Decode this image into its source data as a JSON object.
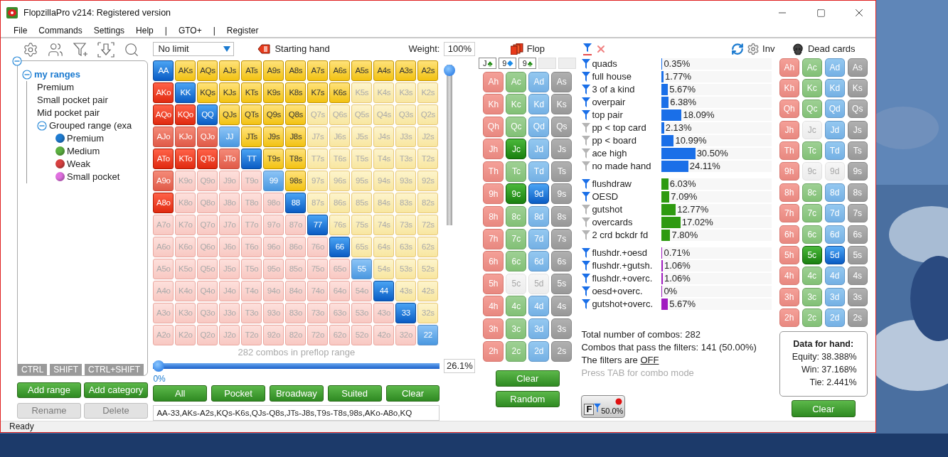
{
  "window": {
    "title": "FlopzillaPro v214: Registered version"
  },
  "menu": [
    "File",
    "Commands",
    "Settings",
    "Help",
    "|",
    "GTO+",
    "|",
    "Register"
  ],
  "tree": {
    "expanded": true,
    "children": [
      {
        "label": "my ranges",
        "expanded": true,
        "children": [
          {
            "label": "Premium"
          },
          {
            "label": "Small pocket pair"
          },
          {
            "label": "Mid pocket pair"
          },
          {
            "label": "Grouped range (exa",
            "expanded": true,
            "children": [
              {
                "label": "Premium",
                "color": "#1f7bd0"
              },
              {
                "label": "Medium",
                "color": "#5cb040"
              },
              {
                "label": "Weak",
                "color": "#d84040"
              },
              {
                "label": "Small pocket",
                "color": "#e070e0"
              }
            ]
          }
        ]
      }
    ]
  },
  "modifier_tabs": [
    "CTRL",
    "SHIFT",
    "CTRL+SHIFT"
  ],
  "range_buttons": [
    {
      "label": "Add range",
      "disabled": false
    },
    {
      "label": "Add category",
      "disabled": false
    },
    {
      "label": "Rename",
      "disabled": true
    },
    {
      "label": "Delete",
      "disabled": true
    }
  ],
  "game_select": {
    "value": "No limit"
  },
  "starting_hand_label": "Starting hand",
  "weight": {
    "label": "Weight:",
    "value": "100%"
  },
  "weight_slider": {
    "level": 1
  },
  "hand_grid": {
    "rows": [
      {
        "cells": [
          {
            "label": "AA",
            "selected": true,
            "partial": false
          },
          {
            "label": "AKs",
            "selected": true,
            "partial": false
          },
          {
            "label": "AQs",
            "selected": true,
            "partial": false
          },
          {
            "label": "AJs",
            "selected": true,
            "partial": false
          },
          {
            "label": "ATs",
            "selected": true,
            "partial": false
          },
          {
            "label": "A9s",
            "selected": true,
            "partial": false
          },
          {
            "label": "A8s",
            "selected": true,
            "partial": false
          },
          {
            "label": "A7s",
            "selected": true,
            "partial": false
          },
          {
            "label": "A6s",
            "selected": true,
            "partial": false
          },
          {
            "label": "A5s",
            "selected": true,
            "partial": false
          },
          {
            "label": "A4s",
            "selected": true,
            "partial": false
          },
          {
            "label": "A3s",
            "selected": true,
            "partial": false
          },
          {
            "label": "A2s",
            "selected": true,
            "partial": false
          }
        ]
      },
      {
        "cells": [
          {
            "label": "AKo",
            "selected": true,
            "partial": false
          },
          {
            "label": "KK",
            "selected": true,
            "partial": false
          },
          {
            "label": "KQs",
            "selected": true,
            "partial": false
          },
          {
            "label": "KJs",
            "selected": true,
            "partial": false
          },
          {
            "label": "KTs",
            "selected": true,
            "partial": false
          },
          {
            "label": "K9s",
            "selected": true,
            "partial": false
          },
          {
            "label": "K8s",
            "selected": true,
            "partial": false
          },
          {
            "label": "K7s",
            "selected": true,
            "partial": false
          },
          {
            "label": "K6s",
            "selected": true,
            "partial": false
          },
          {
            "label": "K5s",
            "selected": false,
            "partial": false
          },
          {
            "label": "K4s",
            "selected": false,
            "partial": false
          },
          {
            "label": "K3s",
            "selected": false,
            "partial": false
          },
          {
            "label": "K2s",
            "selected": false,
            "partial": false
          }
        ]
      },
      {
        "cells": [
          {
            "label": "AQo",
            "selected": true,
            "partial": false
          },
          {
            "label": "KQo",
            "selected": true,
            "partial": false
          },
          {
            "label": "QQ",
            "selected": true,
            "partial": false
          },
          {
            "label": "QJs",
            "selected": true,
            "partial": false
          },
          {
            "label": "QTs",
            "selected": true,
            "partial": false
          },
          {
            "label": "Q9s",
            "selected": true,
            "partial": false
          },
          {
            "label": "Q8s",
            "selected": true,
            "partial": false
          },
          {
            "label": "Q7s",
            "selected": false,
            "partial": false
          },
          {
            "label": "Q6s",
            "selected": false,
            "partial": false
          },
          {
            "label": "Q5s",
            "selected": false,
            "partial": false
          },
          {
            "label": "Q4s",
            "selected": false,
            "partial": false
          },
          {
            "label": "Q3s",
            "selected": false,
            "partial": false
          },
          {
            "label": "Q2s",
            "selected": false,
            "partial": false
          }
        ]
      },
      {
        "cells": [
          {
            "label": "AJo",
            "selected": true,
            "partial": true
          },
          {
            "label": "KJo",
            "selected": true,
            "partial": true
          },
          {
            "label": "QJo",
            "selected": true,
            "partial": true
          },
          {
            "label": "JJ",
            "selected": true,
            "partial": true
          },
          {
            "label": "JTs",
            "selected": true,
            "partial": false
          },
          {
            "label": "J9s",
            "selected": true,
            "partial": false
          },
          {
            "label": "J8s",
            "selected": true,
            "partial": false
          },
          {
            "label": "J7s",
            "selected": false,
            "partial": false
          },
          {
            "label": "J6s",
            "selected": false,
            "partial": false
          },
          {
            "label": "J5s",
            "selected": false,
            "partial": false
          },
          {
            "label": "J4s",
            "selected": false,
            "partial": false
          },
          {
            "label": "J3s",
            "selected": false,
            "partial": false
          },
          {
            "label": "J2s",
            "selected": false,
            "partial": false
          }
        ]
      },
      {
        "cells": [
          {
            "label": "ATo",
            "selected": true,
            "partial": false
          },
          {
            "label": "KTo",
            "selected": true,
            "partial": false
          },
          {
            "label": "QTo",
            "selected": true,
            "partial": false
          },
          {
            "label": "JTo",
            "selected": true,
            "partial": true
          },
          {
            "label": "TT",
            "selected": true,
            "partial": false
          },
          {
            "label": "T9s",
            "selected": true,
            "partial": false
          },
          {
            "label": "T8s",
            "selected": true,
            "partial": false
          },
          {
            "label": "T7s",
            "selected": false,
            "partial": false
          },
          {
            "label": "T6s",
            "selected": false,
            "partial": false
          },
          {
            "label": "T5s",
            "selected": false,
            "partial": false
          },
          {
            "label": "T4s",
            "selected": false,
            "partial": false
          },
          {
            "label": "T3s",
            "selected": false,
            "partial": false
          },
          {
            "label": "T2s",
            "selected": false,
            "partial": false
          }
        ]
      },
      {
        "cells": [
          {
            "label": "A9o",
            "selected": true,
            "partial": true
          },
          {
            "label": "K9o",
            "selected": false,
            "partial": false
          },
          {
            "label": "Q9o",
            "selected": false,
            "partial": false
          },
          {
            "label": "J9o",
            "selected": false,
            "partial": false
          },
          {
            "label": "T9o",
            "selected": false,
            "partial": false
          },
          {
            "label": "99",
            "selected": true,
            "partial": true
          },
          {
            "label": "98s",
            "selected": true,
            "partial": false
          },
          {
            "label": "97s",
            "selected": false,
            "partial": false
          },
          {
            "label": "96s",
            "selected": false,
            "partial": false
          },
          {
            "label": "95s",
            "selected": false,
            "partial": false
          },
          {
            "label": "94s",
            "selected": false,
            "partial": false
          },
          {
            "label": "93s",
            "selected": false,
            "partial": false
          },
          {
            "label": "92s",
            "selected": false,
            "partial": false
          }
        ]
      },
      {
        "cells": [
          {
            "label": "A8o",
            "selected": true,
            "partial": false
          },
          {
            "label": "K8o",
            "selected": false,
            "partial": false
          },
          {
            "label": "Q8o",
            "selected": false,
            "partial": false
          },
          {
            "label": "J8o",
            "selected": false,
            "partial": false
          },
          {
            "label": "T8o",
            "selected": false,
            "partial": false
          },
          {
            "label": "98o",
            "selected": false,
            "partial": false
          },
          {
            "label": "88",
            "selected": true,
            "partial": false
          },
          {
            "label": "87s",
            "selected": false,
            "partial": false
          },
          {
            "label": "86s",
            "selected": false,
            "partial": false
          },
          {
            "label": "85s",
            "selected": false,
            "partial": false
          },
          {
            "label": "84s",
            "selected": false,
            "partial": false
          },
          {
            "label": "83s",
            "selected": false,
            "partial": false
          },
          {
            "label": "82s",
            "selected": false,
            "partial": false
          }
        ]
      },
      {
        "cells": [
          {
            "label": "A7o",
            "selected": false,
            "partial": false
          },
          {
            "label": "K7o",
            "selected": false,
            "partial": false
          },
          {
            "label": "Q7o",
            "selected": false,
            "partial": false
          },
          {
            "label": "J7o",
            "selected": false,
            "partial": false
          },
          {
            "label": "T7o",
            "selected": false,
            "partial": false
          },
          {
            "label": "97o",
            "selected": false,
            "partial": false
          },
          {
            "label": "87o",
            "selected": false,
            "partial": false
          },
          {
            "label": "77",
            "selected": true,
            "partial": false
          },
          {
            "label": "76s",
            "selected": false,
            "partial": false
          },
          {
            "label": "75s",
            "selected": false,
            "partial": false
          },
          {
            "label": "74s",
            "selected": false,
            "partial": false
          },
          {
            "label": "73s",
            "selected": false,
            "partial": false
          },
          {
            "label": "72s",
            "selected": false,
            "partial": false
          }
        ]
      },
      {
        "cells": [
          {
            "label": "A6o",
            "selected": false,
            "partial": false
          },
          {
            "label": "K6o",
            "selected": false,
            "partial": false
          },
          {
            "label": "Q6o",
            "selected": false,
            "partial": false
          },
          {
            "label": "J6o",
            "selected": false,
            "partial": false
          },
          {
            "label": "T6o",
            "selected": false,
            "partial": false
          },
          {
            "label": "96o",
            "selected": false,
            "partial": false
          },
          {
            "label": "86o",
            "selected": false,
            "partial": false
          },
          {
            "label": "76o",
            "selected": false,
            "partial": false
          },
          {
            "label": "66",
            "selected": true,
            "partial": false
          },
          {
            "label": "65s",
            "selected": false,
            "partial": false
          },
          {
            "label": "64s",
            "selected": false,
            "partial": false
          },
          {
            "label": "63s",
            "selected": false,
            "partial": false
          },
          {
            "label": "62s",
            "selected": false,
            "partial": false
          }
        ]
      },
      {
        "cells": [
          {
            "label": "A5o",
            "selected": false,
            "partial": false
          },
          {
            "label": "K5o",
            "selected": false,
            "partial": false
          },
          {
            "label": "Q5o",
            "selected": false,
            "partial": false
          },
          {
            "label": "J5o",
            "selected": false,
            "partial": false
          },
          {
            "label": "T5o",
            "selected": false,
            "partial": false
          },
          {
            "label": "95o",
            "selected": false,
            "partial": false
          },
          {
            "label": "85o",
            "selected": false,
            "partial": false
          },
          {
            "label": "75o",
            "selected": false,
            "partial": false
          },
          {
            "label": "65o",
            "selected": false,
            "partial": false
          },
          {
            "label": "55",
            "selected": true,
            "partial": true
          },
          {
            "label": "54s",
            "selected": false,
            "partial": false
          },
          {
            "label": "53s",
            "selected": false,
            "partial": false
          },
          {
            "label": "52s",
            "selected": false,
            "partial": false
          }
        ]
      },
      {
        "cells": [
          {
            "label": "A4o",
            "selected": false,
            "partial": false
          },
          {
            "label": "K4o",
            "selected": false,
            "partial": false
          },
          {
            "label": "Q4o",
            "selected": false,
            "partial": false
          },
          {
            "label": "J4o",
            "selected": false,
            "partial": false
          },
          {
            "label": "T4o",
            "selected": false,
            "partial": false
          },
          {
            "label": "94o",
            "selected": false,
            "partial": false
          },
          {
            "label": "84o",
            "selected": false,
            "partial": false
          },
          {
            "label": "74o",
            "selected": false,
            "partial": false
          },
          {
            "label": "64o",
            "selected": false,
            "partial": false
          },
          {
            "label": "54o",
            "selected": false,
            "partial": false
          },
          {
            "label": "44",
            "selected": true,
            "partial": false
          },
          {
            "label": "43s",
            "selected": false,
            "partial": false
          },
          {
            "label": "42s",
            "selected": false,
            "partial": false
          }
        ]
      },
      {
        "cells": [
          {
            "label": "A3o",
            "selected": false,
            "partial": false
          },
          {
            "label": "K3o",
            "selected": false,
            "partial": false
          },
          {
            "label": "Q3o",
            "selected": false,
            "partial": false
          },
          {
            "label": "J3o",
            "selected": false,
            "partial": false
          },
          {
            "label": "T3o",
            "selected": false,
            "partial": false
          },
          {
            "label": "93o",
            "selected": false,
            "partial": false
          },
          {
            "label": "83o",
            "selected": false,
            "partial": false
          },
          {
            "label": "73o",
            "selected": false,
            "partial": false
          },
          {
            "label": "63o",
            "selected": false,
            "partial": false
          },
          {
            "label": "53o",
            "selected": false,
            "partial": false
          },
          {
            "label": "43o",
            "selected": false,
            "partial": false
          },
          {
            "label": "33",
            "selected": true,
            "partial": false
          },
          {
            "label": "32s",
            "selected": false,
            "partial": false
          }
        ]
      },
      {
        "cells": [
          {
            "label": "A2o",
            "selected": false,
            "partial": false
          },
          {
            "label": "K2o",
            "selected": false,
            "partial": false
          },
          {
            "label": "Q2o",
            "selected": false,
            "partial": false
          },
          {
            "label": "J2o",
            "selected": false,
            "partial": false
          },
          {
            "label": "T2o",
            "selected": false,
            "partial": false
          },
          {
            "label": "92o",
            "selected": false,
            "partial": false
          },
          {
            "label": "82o",
            "selected": false,
            "partial": false
          },
          {
            "label": "72o",
            "selected": false,
            "partial": false
          },
          {
            "label": "62o",
            "selected": false,
            "partial": false
          },
          {
            "label": "52o",
            "selected": false,
            "partial": false
          },
          {
            "label": "42o",
            "selected": false,
            "partial": false
          },
          {
            "label": "32o",
            "selected": false,
            "partial": false
          },
          {
            "label": "22",
            "selected": true,
            "partial": true
          }
        ]
      }
    ]
  },
  "combos_caption": "282 combos in preflop range",
  "range_slider": {
    "level": 0,
    "min_label": "0%",
    "value": "26.1%"
  },
  "grid_buttons": [
    "All",
    "Pocket",
    "Broadway",
    "Suited",
    "Clear"
  ],
  "range_text": "AA-33,AKs-A2s,KQs-K6s,QJs-Q8s,JTs-J8s,T9s-T8s,98s,AKo-A8o,KQ",
  "flop": {
    "title": "Flop",
    "slots": [
      {
        "kind": "card",
        "rank": "J",
        "suit": "♣",
        "color": "#1e8a10"
      },
      {
        "kind": "card",
        "rank": "9",
        "suit": "◆",
        "color": "#1a8ae8"
      },
      {
        "kind": "card",
        "rank": "9",
        "suit": "♣",
        "color": "#1e8a10"
      },
      {
        "kind": "empty"
      },
      {
        "kind": "empty"
      }
    ],
    "deck": [
      {
        "cards": [
          {
            "label": "Ah",
            "selected": false,
            "disabled": false
          },
          {
            "label": "Ac",
            "selected": false,
            "disabled": false
          },
          {
            "label": "Ad",
            "selected": false,
            "disabled": false
          },
          {
            "label": "As",
            "selected": false,
            "disabled": false
          }
        ]
      },
      {
        "cards": [
          {
            "label": "Kh",
            "selected": false,
            "disabled": false
          },
          {
            "label": "Kc",
            "selected": false,
            "disabled": false
          },
          {
            "label": "Kd",
            "selected": false,
            "disabled": false
          },
          {
            "label": "Ks",
            "selected": false,
            "disabled": false
          }
        ]
      },
      {
        "cards": [
          {
            "label": "Qh",
            "selected": false,
            "disabled": false
          },
          {
            "label": "Qc",
            "selected": false,
            "disabled": false
          },
          {
            "label": "Qd",
            "selected": false,
            "disabled": false
          },
          {
            "label": "Qs",
            "selected": false,
            "disabled": false
          }
        ]
      },
      {
        "cards": [
          {
            "label": "Jh",
            "selected": false,
            "disabled": false
          },
          {
            "label": "Jc",
            "selected": true,
            "disabled": false
          },
          {
            "label": "Jd",
            "selected": false,
            "disabled": false
          },
          {
            "label": "Js",
            "selected": false,
            "disabled": false
          }
        ]
      },
      {
        "cards": [
          {
            "label": "Th",
            "selected": false,
            "disabled": false
          },
          {
            "label": "Tc",
            "selected": false,
            "disabled": false
          },
          {
            "label": "Td",
            "selected": false,
            "disabled": false
          },
          {
            "label": "Ts",
            "selected": false,
            "disabled": false
          }
        ]
      },
      {
        "cards": [
          {
            "label": "9h",
            "selected": false,
            "disabled": false
          },
          {
            "label": "9c",
            "selected": true,
            "disabled": false
          },
          {
            "label": "9d",
            "selected": true,
            "disabled": false
          },
          {
            "label": "9s",
            "selected": false,
            "disabled": false
          }
        ]
      },
      {
        "cards": [
          {
            "label": "8h",
            "selected": false,
            "disabled": false
          },
          {
            "label": "8c",
            "selected": false,
            "disabled": false
          },
          {
            "label": "8d",
            "selected": false,
            "disabled": false
          },
          {
            "label": "8s",
            "selected": false,
            "disabled": false
          }
        ]
      },
      {
        "cards": [
          {
            "label": "7h",
            "selected": false,
            "disabled": false
          },
          {
            "label": "7c",
            "selected": false,
            "disabled": false
          },
          {
            "label": "7d",
            "selected": false,
            "disabled": false
          },
          {
            "label": "7s",
            "selected": false,
            "disabled": false
          }
        ]
      },
      {
        "cards": [
          {
            "label": "6h",
            "selected": false,
            "disabled": false
          },
          {
            "label": "6c",
            "selected": false,
            "disabled": false
          },
          {
            "label": "6d",
            "selected": false,
            "disabled": false
          },
          {
            "label": "6s",
            "selected": false,
            "disabled": false
          }
        ]
      },
      {
        "cards": [
          {
            "label": "5h",
            "selected": false,
            "disabled": false
          },
          {
            "label": "5c",
            "selected": false,
            "disabled": true
          },
          {
            "label": "5d",
            "selected": false,
            "disabled": true
          },
          {
            "label": "5s",
            "selected": false,
            "disabled": false
          }
        ]
      },
      {
        "cards": [
          {
            "label": "4h",
            "selected": false,
            "disabled": false
          },
          {
            "label": "4c",
            "selected": false,
            "disabled": false
          },
          {
            "label": "4d",
            "selected": false,
            "disabled": false
          },
          {
            "label": "4s",
            "selected": false,
            "disabled": false
          }
        ]
      },
      {
        "cards": [
          {
            "label": "3h",
            "selected": false,
            "disabled": false
          },
          {
            "label": "3c",
            "selected": false,
            "disabled": false
          },
          {
            "label": "3d",
            "selected": false,
            "disabled": false
          },
          {
            "label": "3s",
            "selected": false,
            "disabled": false
          }
        ]
      },
      {
        "cards": [
          {
            "label": "2h",
            "selected": false,
            "disabled": false
          },
          {
            "label": "2c",
            "selected": false,
            "disabled": false
          },
          {
            "label": "2d",
            "selected": false,
            "disabled": false
          },
          {
            "label": "2s",
            "selected": false,
            "disabled": false
          }
        ]
      }
    ],
    "buttons": [
      "Clear",
      "Random"
    ]
  },
  "filters": {
    "inv_label": "Inv",
    "groups": [
      {
        "kind": "made",
        "rows": [
          {
            "label": "quads",
            "value": "0.35%",
            "level": 0.0035,
            "active": true
          },
          {
            "label": "full house",
            "value": "1.77%",
            "level": 0.0177,
            "active": true
          },
          {
            "label": "3 of a kind",
            "value": "5.67%",
            "level": 0.0567,
            "active": true
          },
          {
            "label": "overpair",
            "value": "6.38%",
            "level": 0.0638,
            "active": true
          },
          {
            "label": "top pair",
            "value": "18.09%",
            "level": 0.1809,
            "active": true
          },
          {
            "label": "pp < top card",
            "value": "2.13%",
            "level": 0.0213,
            "active": false
          },
          {
            "label": "pp < board",
            "value": "10.99%",
            "level": 0.1099,
            "active": false
          },
          {
            "label": "ace high",
            "value": "30.50%",
            "level": 0.305,
            "active": false
          },
          {
            "label": "no made hand",
            "value": "24.11%",
            "level": 0.2411,
            "active": false
          }
        ]
      },
      {
        "kind": "draw",
        "rows": [
          {
            "label": "flushdraw",
            "value": "6.03%",
            "level": 0.0603,
            "active": true
          },
          {
            "label": "OESD",
            "value": "7.09%",
            "level": 0.0709,
            "active": true
          },
          {
            "label": "gutshot",
            "value": "12.77%",
            "level": 0.1277,
            "active": false
          },
          {
            "label": "overcards",
            "value": "17.02%",
            "level": 0.1702,
            "active": false
          },
          {
            "label": "2 crd bckdr fd",
            "value": "7.80%",
            "level": 0.078,
            "active": false
          }
        ]
      },
      {
        "kind": "combo",
        "rows": [
          {
            "label": "flushdr.+oesd",
            "value": "0.71%",
            "level": 0.0071,
            "active": true
          },
          {
            "label": "flushdr.+gutsh.",
            "value": "1.06%",
            "level": 0.0106,
            "active": true
          },
          {
            "label": "flushdr.+overc.",
            "value": "1.06%",
            "level": 0.0106,
            "active": true
          },
          {
            "label": "oesd+overc.",
            "value": "0%",
            "level": 0,
            "active": true
          },
          {
            "label": "gutshot+overc.",
            "value": "5.67%",
            "level": 0.0567,
            "active": true
          }
        ]
      }
    ],
    "total_combos": "Total number of combos: 282",
    "passing_combos": "Combos that pass the filters: 141 (50.00%)",
    "filters_state_prefix": "The filters are",
    "filters_state_link": "OFF",
    "hint": "Press TAB for combo mode",
    "toggle": {
      "letter": "F",
      "value": "50.0%"
    }
  },
  "dead_cards": {
    "title": "Dead cards",
    "deck": [
      {
        "cards": [
          {
            "label": "Ah",
            "selected": false,
            "disabled": false
          },
          {
            "label": "Ac",
            "selected": false,
            "disabled": false
          },
          {
            "label": "Ad",
            "selected": false,
            "disabled": false
          },
          {
            "label": "As",
            "selected": false,
            "disabled": false
          }
        ]
      },
      {
        "cards": [
          {
            "label": "Kh",
            "selected": false,
            "disabled": false
          },
          {
            "label": "Kc",
            "selected": false,
            "disabled": false
          },
          {
            "label": "Kd",
            "selected": false,
            "disabled": false
          },
          {
            "label": "Ks",
            "selected": false,
            "disabled": false
          }
        ]
      },
      {
        "cards": [
          {
            "label": "Qh",
            "selected": false,
            "disabled": false
          },
          {
            "label": "Qc",
            "selected": false,
            "disabled": false
          },
          {
            "label": "Qd",
            "selected": false,
            "disabled": false
          },
          {
            "label": "Qs",
            "selected": false,
            "disabled": false
          }
        ]
      },
      {
        "cards": [
          {
            "label": "Jh",
            "selected": false,
            "disabled": false
          },
          {
            "label": "Jc",
            "selected": false,
            "disabled": true
          },
          {
            "label": "Jd",
            "selected": false,
            "disabled": false
          },
          {
            "label": "Js",
            "selected": false,
            "disabled": false
          }
        ]
      },
      {
        "cards": [
          {
            "label": "Th",
            "selected": false,
            "disabled": false
          },
          {
            "label": "Tc",
            "selected": false,
            "disabled": false
          },
          {
            "label": "Td",
            "selected": false,
            "disabled": false
          },
          {
            "label": "Ts",
            "selected": false,
            "disabled": false
          }
        ]
      },
      {
        "cards": [
          {
            "label": "9h",
            "selected": false,
            "disabled": false
          },
          {
            "label": "9c",
            "selected": false,
            "disabled": true
          },
          {
            "label": "9d",
            "selected": false,
            "disabled": true
          },
          {
            "label": "9s",
            "selected": false,
            "disabled": false
          }
        ]
      },
      {
        "cards": [
          {
            "label": "8h",
            "selected": false,
            "disabled": false
          },
          {
            "label": "8c",
            "selected": false,
            "disabled": false
          },
          {
            "label": "8d",
            "selected": false,
            "disabled": false
          },
          {
            "label": "8s",
            "selected": false,
            "disabled": false
          }
        ]
      },
      {
        "cards": [
          {
            "label": "7h",
            "selected": false,
            "disabled": false
          },
          {
            "label": "7c",
            "selected": false,
            "disabled": false
          },
          {
            "label": "7d",
            "selected": false,
            "disabled": false
          },
          {
            "label": "7s",
            "selected": false,
            "disabled": false
          }
        ]
      },
      {
        "cards": [
          {
            "label": "6h",
            "selected": false,
            "disabled": false
          },
          {
            "label": "6c",
            "selected": false,
            "disabled": false
          },
          {
            "label": "6d",
            "selected": false,
            "disabled": false
          },
          {
            "label": "6s",
            "selected": false,
            "disabled": false
          }
        ]
      },
      {
        "cards": [
          {
            "label": "5h",
            "selected": false,
            "disabled": false
          },
          {
            "label": "5c",
            "selected": true,
            "disabled": false
          },
          {
            "label": "5d",
            "selected": true,
            "disabled": false
          },
          {
            "label": "5s",
            "selected": false,
            "disabled": false
          }
        ]
      },
      {
        "cards": [
          {
            "label": "4h",
            "selected": false,
            "disabled": false
          },
          {
            "label": "4c",
            "selected": false,
            "disabled": false
          },
          {
            "label": "4d",
            "selected": false,
            "disabled": false
          },
          {
            "label": "4s",
            "selected": false,
            "disabled": false
          }
        ]
      },
      {
        "cards": [
          {
            "label": "3h",
            "selected": false,
            "disabled": false
          },
          {
            "label": "3c",
            "selected": false,
            "disabled": false
          },
          {
            "label": "3d",
            "selected": false,
            "disabled": false
          },
          {
            "label": "3s",
            "selected": false,
            "disabled": false
          }
        ]
      },
      {
        "cards": [
          {
            "label": "2h",
            "selected": false,
            "disabled": false
          },
          {
            "label": "2c",
            "selected": false,
            "disabled": false
          },
          {
            "label": "2d",
            "selected": false,
            "disabled": false
          },
          {
            "label": "2s",
            "selected": false,
            "disabled": false
          }
        ]
      }
    ],
    "data_title": "Data for hand:",
    "data_lines": [
      "Equity: 38.388%",
      "Win: 37.168%",
      "Tie: 2.441%"
    ],
    "button": "Clear"
  },
  "status_bar": "Ready"
}
